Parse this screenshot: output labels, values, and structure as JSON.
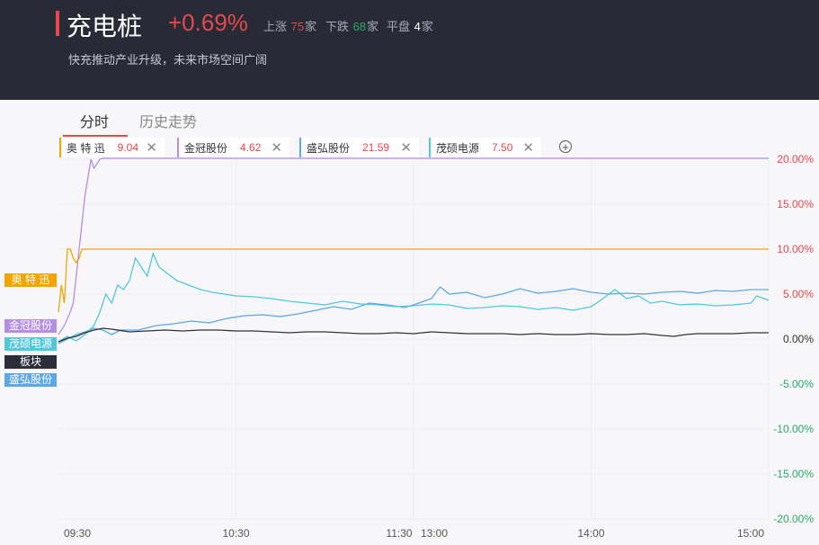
{
  "header": {
    "title": "充电桩",
    "change_pct": "+0.69%",
    "up_label": "上涨",
    "up_count": "75",
    "up_unit": "家",
    "down_label": "下跌",
    "down_count": "68",
    "down_unit": "家",
    "flat_label": "平盘",
    "flat_count": "4",
    "flat_unit": "家",
    "description": "快充推动产业升级，未来市场空间广阔"
  },
  "tabs": [
    {
      "label": "分时",
      "active": true
    },
    {
      "label": "历史走势",
      "active": false
    }
  ],
  "chips": [
    {
      "name": "奥 特 迅",
      "value": "9.04",
      "color": "#f0a500"
    },
    {
      "name": "金冠股份",
      "value": "4.62",
      "color": "#b48ee6"
    },
    {
      "name": "盛弘股份",
      "value": "21.59",
      "color": "#5aa8e8"
    },
    {
      "name": "茂硕电源",
      "value": "7.50",
      "color": "#4fc8dc"
    }
  ],
  "tags": [
    {
      "label": "奥 特 迅",
      "color": "#f0a500"
    },
    {
      "label": "金冠股份",
      "color": "#b48ee6"
    },
    {
      "label": "茂硕电源",
      "color": "#4fc8dc"
    },
    {
      "label": "板块",
      "color": "#2b2d3a"
    },
    {
      "label": "盛弘股份",
      "color": "#5aa8e8"
    }
  ],
  "chart_data": {
    "type": "line",
    "x_unit": "minute index (0=09:30, 120=11:30/13:00, 240=15:00)",
    "x_ticks": [
      {
        "label": "09:30",
        "x": 0
      },
      {
        "label": "10:30",
        "x": 60
      },
      {
        "label": "11:30",
        "x": 120
      },
      {
        "label": "13:00",
        "x": 120
      },
      {
        "label": "14:00",
        "x": 180
      },
      {
        "label": "15:00",
        "x": 240
      }
    ],
    "y_ticks": [
      "20.00%",
      "15.00%",
      "10.00%",
      "5.00%",
      "0.00%",
      "-5.00%",
      "-10.00%",
      "-15.00%",
      "-20.00%"
    ],
    "y_tick_values": [
      20,
      15,
      10,
      5,
      0,
      -5,
      -10,
      -15,
      -20
    ],
    "ylim": [
      -20,
      20
    ],
    "positive_color": "#e5484d",
    "negative_color": "#2aa86b",
    "series": [
      {
        "name": "金冠股份",
        "color": "#b48ee6",
        "points": [
          [
            0,
            0.5
          ],
          [
            2,
            1.5
          ],
          [
            4,
            3
          ],
          [
            5,
            4
          ],
          [
            6,
            7
          ],
          [
            7,
            10
          ],
          [
            8,
            13
          ],
          [
            9,
            16
          ],
          [
            10,
            18
          ],
          [
            11,
            20
          ],
          [
            12,
            19
          ],
          [
            13,
            19.5
          ],
          [
            14,
            20
          ],
          [
            15,
            20.1
          ],
          [
            20,
            20.1
          ],
          [
            240,
            20.1
          ]
        ]
      },
      {
        "name": "奥 特 迅",
        "color": "#f0a500",
        "points": [
          [
            0,
            3
          ],
          [
            1,
            6
          ],
          [
            2,
            4
          ],
          [
            3,
            10
          ],
          [
            4,
            10
          ],
          [
            5,
            9
          ],
          [
            6,
            8.5
          ],
          [
            7,
            9
          ],
          [
            8,
            10
          ],
          [
            9,
            10
          ],
          [
            240,
            10
          ]
        ]
      },
      {
        "name": "盛弘股份",
        "color": "#5aa8e8",
        "points": [
          [
            0,
            -0.5
          ],
          [
            3,
            0
          ],
          [
            6,
            0.5
          ],
          [
            9,
            0.8
          ],
          [
            12,
            1.2
          ],
          [
            15,
            1.0
          ],
          [
            18,
            0.5
          ],
          [
            21,
            1.0
          ],
          [
            27,
            1.0
          ],
          [
            33,
            1.5
          ],
          [
            39,
            1.7
          ],
          [
            45,
            2.0
          ],
          [
            51,
            1.8
          ],
          [
            57,
            2.3
          ],
          [
            63,
            2.6
          ],
          [
            69,
            2.7
          ],
          [
            75,
            2.5
          ],
          [
            81,
            2.8
          ],
          [
            87,
            3.2
          ],
          [
            93,
            3.6
          ],
          [
            99,
            3.3
          ],
          [
            105,
            4.0
          ],
          [
            111,
            3.8
          ],
          [
            117,
            3.5
          ],
          [
            120,
            3.8
          ],
          [
            126,
            4.5
          ],
          [
            129,
            5.8
          ],
          [
            132,
            5.0
          ],
          [
            138,
            5.2
          ],
          [
            144,
            4.6
          ],
          [
            150,
            5.0
          ],
          [
            156,
            5.6
          ],
          [
            162,
            5.1
          ],
          [
            168,
            5.3
          ],
          [
            174,
            5.6
          ],
          [
            180,
            5.2
          ],
          [
            186,
            5.0
          ],
          [
            192,
            5.1
          ],
          [
            198,
            5.0
          ],
          [
            204,
            5.2
          ],
          [
            210,
            5.3
          ],
          [
            216,
            5.1
          ],
          [
            222,
            5.4
          ],
          [
            228,
            5.3
          ],
          [
            234,
            5.5
          ],
          [
            240,
            5.5
          ]
        ]
      },
      {
        "name": "茂硕电源",
        "color": "#4fc8dc",
        "points": [
          [
            0,
            -0.3
          ],
          [
            3,
            0.3
          ],
          [
            6,
            -0.2
          ],
          [
            9,
            0.5
          ],
          [
            12,
            1.5
          ],
          [
            14,
            3
          ],
          [
            16,
            5
          ],
          [
            18,
            4
          ],
          [
            20,
            6
          ],
          [
            22,
            5.5
          ],
          [
            24,
            6.5
          ],
          [
            26,
            9
          ],
          [
            28,
            8
          ],
          [
            30,
            7
          ],
          [
            32,
            9.5
          ],
          [
            34,
            8
          ],
          [
            36,
            7.5
          ],
          [
            40,
            6.5
          ],
          [
            44,
            6
          ],
          [
            48,
            5.5
          ],
          [
            52,
            5.2
          ],
          [
            56,
            5
          ],
          [
            60,
            4.8
          ],
          [
            66,
            4.7
          ],
          [
            72,
            4.5
          ],
          [
            78,
            4.2
          ],
          [
            84,
            4
          ],
          [
            90,
            3.8
          ],
          [
            96,
            4.2
          ],
          [
            102,
            3.9
          ],
          [
            108,
            3.8
          ],
          [
            114,
            3.6
          ],
          [
            120,
            3.7
          ],
          [
            126,
            3.9
          ],
          [
            132,
            3.8
          ],
          [
            138,
            3.4
          ],
          [
            144,
            3.5
          ],
          [
            150,
            3.7
          ],
          [
            156,
            3.6
          ],
          [
            162,
            3.3
          ],
          [
            168,
            3.5
          ],
          [
            174,
            3.2
          ],
          [
            180,
            3.6
          ],
          [
            184,
            4.5
          ],
          [
            188,
            5.5
          ],
          [
            192,
            4.5
          ],
          [
            196,
            4.8
          ],
          [
            200,
            4.0
          ],
          [
            204,
            4.2
          ],
          [
            210,
            3.8
          ],
          [
            216,
            3.9
          ],
          [
            222,
            3.7
          ],
          [
            228,
            3.8
          ],
          [
            234,
            4.0
          ],
          [
            236,
            4.8
          ],
          [
            240,
            4.3
          ]
        ]
      },
      {
        "name": "板块",
        "color": "#333333",
        "points": [
          [
            0,
            -0.3
          ],
          [
            3,
            0.1
          ],
          [
            6,
            0.3
          ],
          [
            9,
            0.7
          ],
          [
            12,
            1.0
          ],
          [
            15,
            1.2
          ],
          [
            18,
            1.1
          ],
          [
            24,
            0.8
          ],
          [
            30,
            0.9
          ],
          [
            36,
            1.0
          ],
          [
            42,
            0.9
          ],
          [
            48,
            1.0
          ],
          [
            54,
            1.0
          ],
          [
            60,
            0.9
          ],
          [
            66,
            0.9
          ],
          [
            72,
            0.8
          ],
          [
            78,
            0.7
          ],
          [
            84,
            0.8
          ],
          [
            90,
            0.8
          ],
          [
            96,
            0.7
          ],
          [
            102,
            0.6
          ],
          [
            108,
            0.6
          ],
          [
            114,
            0.7
          ],
          [
            120,
            0.6
          ],
          [
            126,
            0.8
          ],
          [
            132,
            0.7
          ],
          [
            138,
            0.6
          ],
          [
            144,
            0.6
          ],
          [
            150,
            0.6
          ],
          [
            156,
            0.5
          ],
          [
            162,
            0.6
          ],
          [
            168,
            0.5
          ],
          [
            174,
            0.5
          ],
          [
            180,
            0.6
          ],
          [
            186,
            0.5
          ],
          [
            192,
            0.5
          ],
          [
            198,
            0.6
          ],
          [
            204,
            0.4
          ],
          [
            208,
            0.3
          ],
          [
            212,
            0.5
          ],
          [
            216,
            0.6
          ],
          [
            222,
            0.6
          ],
          [
            228,
            0.6
          ],
          [
            234,
            0.7
          ],
          [
            240,
            0.7
          ]
        ]
      }
    ]
  }
}
